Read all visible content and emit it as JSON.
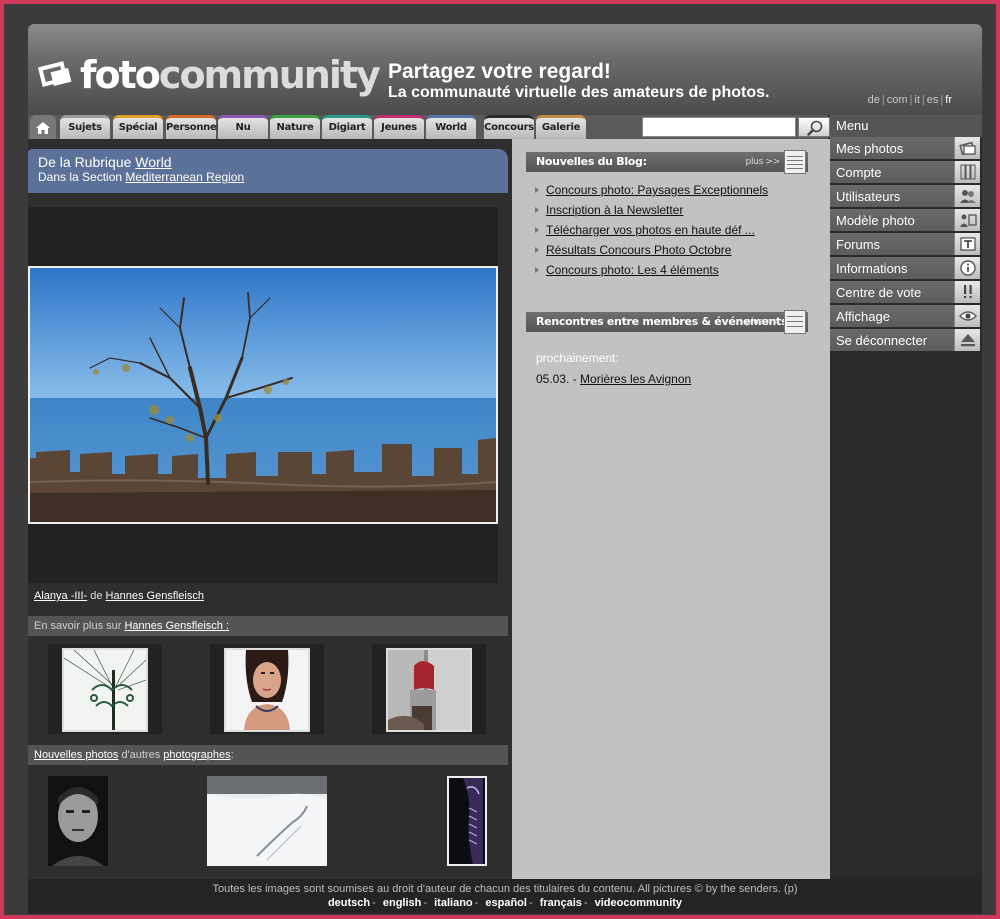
{
  "header": {
    "logo_part1": "foto",
    "logo_part2": "community",
    "tagline_1": "Partagez votre regard!",
    "tagline_2": "La communauté virtuelle des amateurs de photos.",
    "languages": [
      "de",
      "com",
      "it",
      "es",
      "fr"
    ],
    "current_language": "fr"
  },
  "tabs": [
    {
      "label": "Sujets",
      "color": "#9a9a9a"
    },
    {
      "label": "Spécial",
      "color": "#e0a02a"
    },
    {
      "label": "Personnes",
      "color": "#d06a2a"
    },
    {
      "label": "Nu",
      "color": "#8a5ab0"
    },
    {
      "label": "Nature",
      "color": "#3aa040"
    },
    {
      "label": "Digiart",
      "color": "#2a9a8a"
    },
    {
      "label": "Jeunes",
      "color": "#c0306a"
    },
    {
      "label": "World",
      "color": "#5a72a8"
    },
    {
      "label": "Concours",
      "color": "#2a2a2a"
    },
    {
      "label": "Galerie",
      "color": "#c08a40"
    }
  ],
  "search": {
    "value": "",
    "placeholder": ""
  },
  "rubrique": {
    "line1_prefix": "De la Rubrique ",
    "line1_link": "World",
    "line2_prefix": "Dans la Section ",
    "line2_link": "Mediterranean Region"
  },
  "photo": {
    "title": "Alanya -III-",
    "by": " de ",
    "author": "Hannes Gensfleisch"
  },
  "more_about": {
    "prefix": "En savoir plus sur ",
    "author": "Hannes Gensfleisch :"
  },
  "new_photos": {
    "link1": "Nouvelles photos",
    "middle": " d'autres ",
    "link2": "photographes",
    "suffix": ":"
  },
  "blog": {
    "title": "Nouvelles du Blog:",
    "more": "plus >>",
    "items": [
      "Concours photo: Paysages Exceptionnels",
      "Inscription à la Newsletter",
      "Télécharger vos photos en haute déf ...",
      "Résultats Concours Photo Octobre",
      "Concours photo: Les 4 éléments"
    ]
  },
  "events": {
    "title": "Rencontres entre membres & événements",
    "more": "plus >>",
    "soon_label": "prochainement:",
    "date": "05.03. - ",
    "place": "Morières les Avignon"
  },
  "menu": {
    "title": "Menu",
    "items": [
      {
        "label": "Mes photos",
        "icon": "photos-icon"
      },
      {
        "label": "Compte",
        "icon": "account-icon"
      },
      {
        "label": "Utilisateurs",
        "icon": "users-icon"
      },
      {
        "label": "Modèle photo",
        "icon": "model-icon"
      },
      {
        "label": "Forums",
        "icon": "forum-icon"
      },
      {
        "label": "Informations",
        "icon": "info-icon"
      },
      {
        "label": "Centre de vote",
        "icon": "vote-icon"
      },
      {
        "label": "Affichage",
        "icon": "eye-icon"
      },
      {
        "label": "Se déconnecter",
        "icon": "eject-icon"
      }
    ]
  },
  "footer": {
    "copyright": "Toutes les images sont soumises au droit d'auteur de chacun des titulaires du contenu. All pictures © by the senders. (p)",
    "links": [
      "deutsch",
      "english",
      "italiano",
      "español",
      "français",
      "videocommunity"
    ]
  }
}
